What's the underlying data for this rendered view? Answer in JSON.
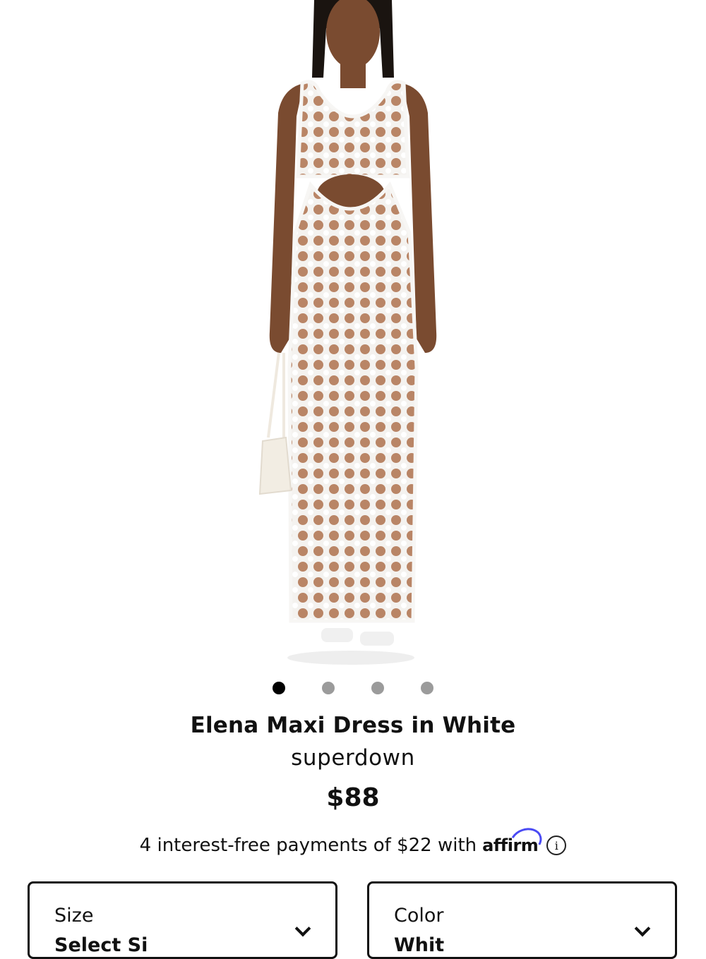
{
  "product": {
    "image_alt": "Model wearing white crochet maxi dress",
    "name": "Elena Maxi Dress in White",
    "brand": "superdown",
    "price": "$88"
  },
  "carousel": {
    "total": 4,
    "active_index": 0
  },
  "financing": {
    "text": "4 interest-free payments of $22 with",
    "provider": "affirm",
    "info_symbol": "i",
    "accent_color": "#4a4af4"
  },
  "options": {
    "size": {
      "label": "Size",
      "value": "Select Si"
    },
    "color": {
      "label": "Color",
      "value": "Whit"
    }
  }
}
